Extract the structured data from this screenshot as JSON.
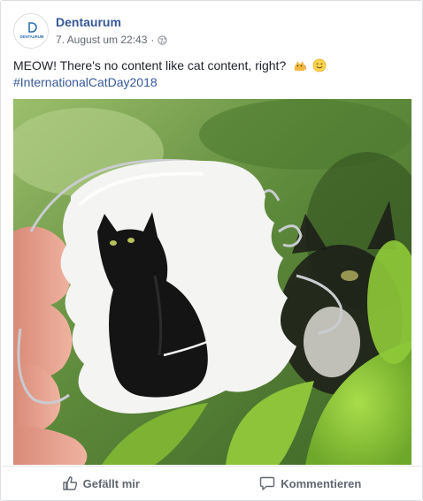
{
  "post": {
    "page_name": "Dentaurum",
    "avatar_logo_text": "DENTAURUM",
    "timestamp": "7. August um 22:43",
    "separator": "·",
    "privacy_icon": "globe-icon",
    "text": "MEOW! There's no content like cat content, right?",
    "emojis": [
      "cat-emoji",
      "smile-emoji"
    ],
    "hashtag": "#InternationalCatDay2018",
    "image_alt": "Cat photo on a dental retainer in front of a real cat"
  },
  "actions": {
    "like_label": "Gefällt mir",
    "like_icon": "thumbs-up-icon",
    "comment_label": "Kommentieren",
    "comment_icon": "comment-icon"
  },
  "colors": {
    "link": "#365899",
    "meta": "#616770",
    "text": "#1d2129",
    "border": "#dddfe2"
  }
}
